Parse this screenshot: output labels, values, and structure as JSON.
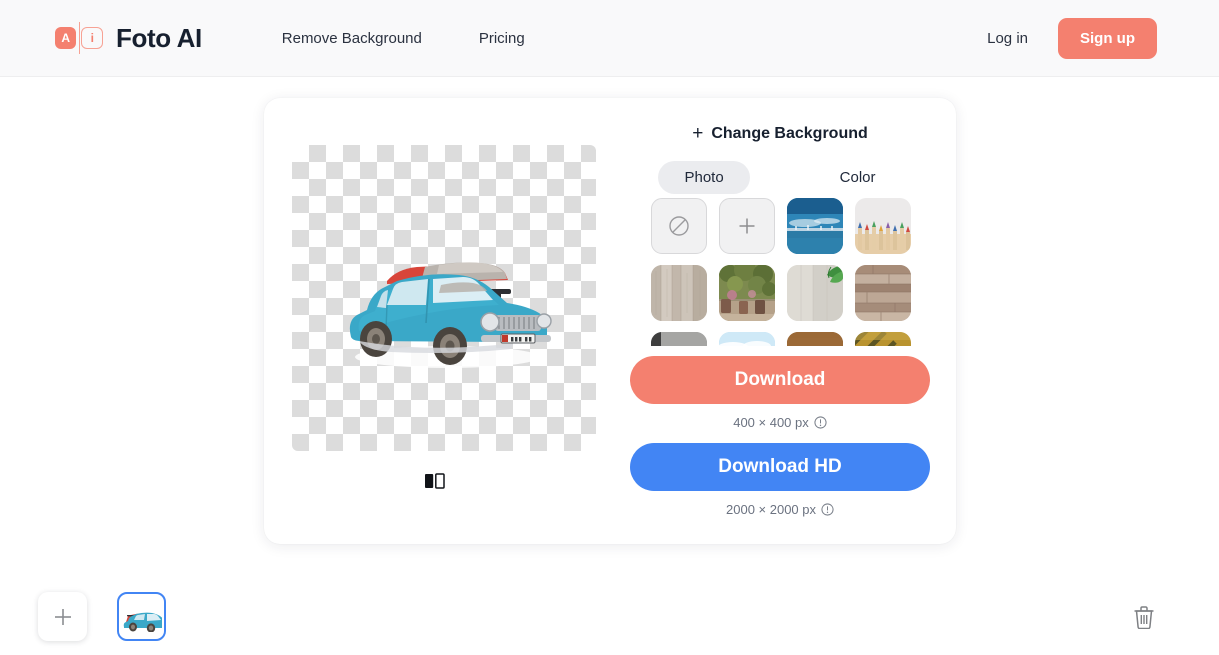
{
  "header": {
    "logo": {
      "icon": "logo-ai-badge",
      "mark_left": "A",
      "mark_right": "i",
      "accent": "#f4806f"
    },
    "brand_name": "Foto AI",
    "nav": [
      {
        "label": "Remove Background",
        "name": "nav-remove-background"
      },
      {
        "label": "Pricing",
        "name": "nav-pricing"
      }
    ],
    "login_label": "Log in",
    "signup_label": "Sign up",
    "signup_color": "#f4806f",
    "background": "#f9f9fa"
  },
  "editor": {
    "preview": {
      "alt": "blue vintage car with luggage on roof rack, transparent background",
      "compare_icon": "before-after-compare-icon"
    },
    "panel": {
      "title": "Change Background",
      "title_icon": "plus-icon",
      "tabs": [
        {
          "label": "Photo",
          "active": true,
          "name": "tab-photo"
        },
        {
          "label": "Color",
          "active": false,
          "name": "tab-color"
        }
      ],
      "thumbnails": [
        {
          "name": "background-none",
          "type": "icon",
          "icon": "no-background-icon"
        },
        {
          "name": "background-upload",
          "type": "icon",
          "icon": "plus-icon"
        },
        {
          "name": "background-sea-sky",
          "type": "image",
          "desc": "blue sea and sky horizon"
        },
        {
          "name": "background-pencils",
          "type": "image",
          "desc": "colored pencils on white"
        },
        {
          "name": "background-wood-vertical",
          "type": "image",
          "desc": "weathered vertical wood planks"
        },
        {
          "name": "background-garden",
          "type": "image",
          "desc": "green garden with plants and pots"
        },
        {
          "name": "background-concrete-leaf",
          "type": "image",
          "desc": "light concrete with green leaves"
        },
        {
          "name": "background-reclaimed-wood",
          "type": "image",
          "desc": "horizontal reclaimed wood wall"
        },
        {
          "name": "background-gray-stone",
          "type": "image",
          "desc": "gray stone surface"
        },
        {
          "name": "background-sky-clouds",
          "type": "image",
          "desc": "blue sky with white clouds"
        },
        {
          "name": "background-brown-wood",
          "type": "image",
          "desc": "warm brown wood grain"
        },
        {
          "name": "background-olive-stripes",
          "type": "image",
          "desc": "olive and yellow striped pattern"
        }
      ]
    },
    "download": {
      "standard_label": "Download",
      "standard_color": "#f4806f",
      "standard_size": "400 × 400 px",
      "hd_label": "Download HD",
      "hd_color": "#4285f4",
      "hd_size": "2000 × 2000 px",
      "info_icon": "info-circle-icon"
    }
  },
  "bottom_bar": {
    "add_icon": "plus-icon",
    "file_thumb_name": "uploaded-car-image",
    "delete_icon": "trash-icon",
    "selected_border": "#4285f4"
  }
}
